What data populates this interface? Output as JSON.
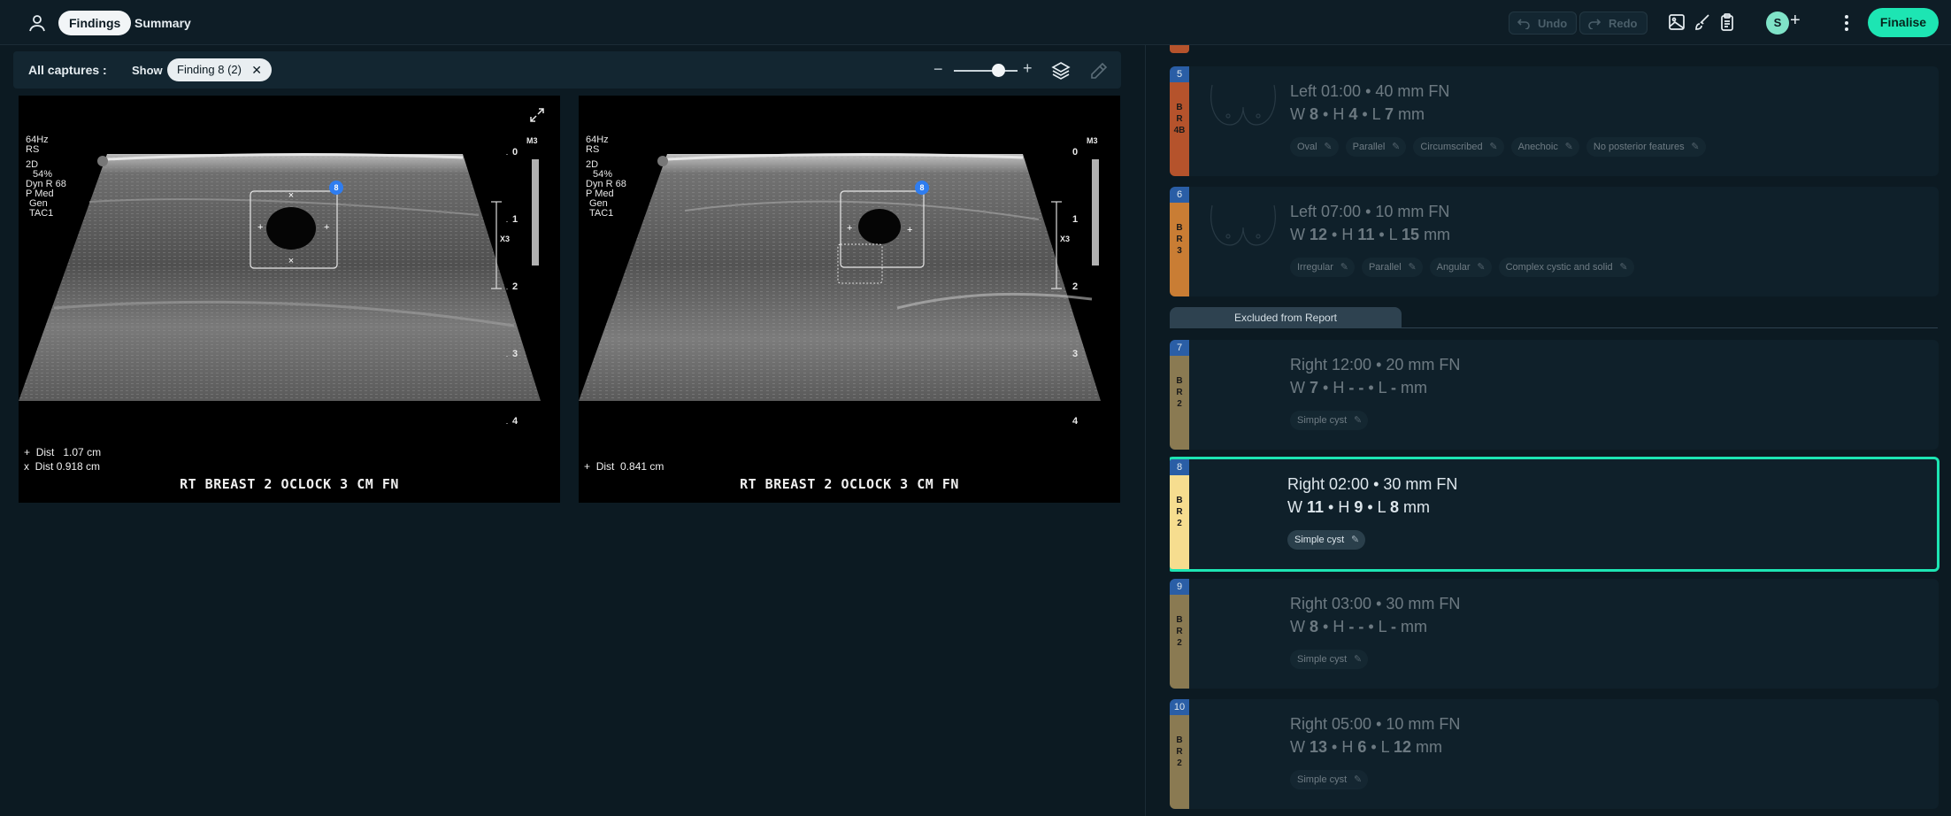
{
  "topbar": {
    "tabs": [
      {
        "label": "Findings",
        "active": true
      },
      {
        "label": "Summary",
        "active": false
      }
    ],
    "undo_label": "Undo",
    "redo_label": "Redo",
    "avatar_initial": "S",
    "finalise_label": "Finalise"
  },
  "captures": {
    "title": "All captures :",
    "show_label": "Show",
    "filter_chip": "Finding 8 (2)"
  },
  "images": [
    {
      "meta": [
        "64Hz",
        "RS",
        "",
        "2D",
        "  54%",
        "Dyn R 68",
        "P Med",
        " Gen",
        " TAC1"
      ],
      "dist": [
        {
          "marker": "+",
          "label": "Dist",
          "value": "1.07 cm"
        },
        {
          "marker": "x",
          "label": "Dist",
          "value": "0.918 cm"
        }
      ],
      "caption": "RT BREAST  2 OCLOCK   3 CM FN",
      "depth_labels": [
        "0",
        "1",
        "2",
        "3",
        "4"
      ],
      "scale_label": "X3",
      "mode_label": "M3",
      "badge": "8"
    },
    {
      "meta": [
        "64Hz",
        "RS",
        "",
        "2D",
        "  54%",
        "Dyn R 68",
        "P Med",
        " Gen",
        " TAC1"
      ],
      "dist": [
        {
          "marker": "+",
          "label": "Dist",
          "value": "0.841 cm"
        }
      ],
      "caption": "RT BREAST  2 OCLOCK   3 CM FN",
      "depth_labels": [
        "0",
        "1",
        "2",
        "3",
        "4"
      ],
      "scale_label": "X3",
      "mode_label": "M3",
      "badge": "8"
    }
  ],
  "excluded_label": "Excluded from Report",
  "findings": [
    {
      "num": "5",
      "birads": [
        "B",
        "R",
        "4B"
      ],
      "color": "#b5532c",
      "location": "Left 01:00 • 40 mm FN",
      "w": "8",
      "h": "4",
      "l": "7",
      "tags": [
        "Oval",
        "Parallel",
        "Circumscribed",
        "Anechoic",
        "No posterior features"
      ],
      "dim": true
    },
    {
      "num": "6",
      "birads": [
        "B",
        "R",
        "3"
      ],
      "color": "#c97d34",
      "location": "Left 07:00 • 10 mm FN",
      "w": "12",
      "h": "11",
      "l": "15",
      "tags": [
        "Irregular",
        "Parallel",
        "Angular",
        "Complex cystic and solid"
      ],
      "dim": true
    },
    {
      "num": "7",
      "birads": [
        "B",
        "R",
        "2"
      ],
      "color": "#e3cf93",
      "location": "Right 12:00 • 20 mm FN",
      "w": "7",
      "h": "- -",
      "l": "-",
      "tags": [
        "Simple cyst"
      ],
      "dim": true
    },
    {
      "num": "8",
      "birads": [
        "B",
        "R",
        "2"
      ],
      "color": "#f6dd8f",
      "location": "Right 02:00 • 30 mm FN",
      "w": "11",
      "h": "9",
      "l": "8",
      "tags": [
        "Simple cyst"
      ],
      "dim": false
    },
    {
      "num": "9",
      "birads": [
        "B",
        "R",
        "2"
      ],
      "color": "#e3cf93",
      "location": "Right 03:00 • 30 mm FN",
      "w": "8",
      "h": "- -",
      "l": "-",
      "tags": [
        "Simple cyst"
      ],
      "dim": true
    },
    {
      "num": "10",
      "birads": [
        "B",
        "R",
        "2"
      ],
      "color": "#e3cf93",
      "location": "Right 05:00 • 10 mm FN",
      "w": "13",
      "h": "6",
      "l": "12",
      "tags": [
        "Simple cyst"
      ],
      "dim": true
    }
  ]
}
